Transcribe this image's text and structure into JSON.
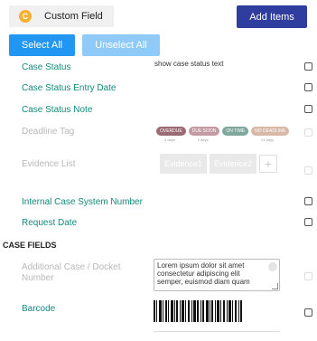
{
  "toolbar": {
    "custom_field_icon": "C",
    "custom_field_label": "Custom Field",
    "add_items_label": "Add Items",
    "select_all_label": "Select All",
    "unselect_all_label": "Unselect All"
  },
  "fields": [
    {
      "label": "Case Status",
      "preview": "show case status text"
    },
    {
      "label": "Case Status Entry Date"
    },
    {
      "label": "Case Status Note"
    },
    {
      "label": "Deadline Tag"
    },
    {
      "label": "Evidence List"
    },
    {
      "label": "Internal Case System Number"
    },
    {
      "label": "Request Date"
    }
  ],
  "deadline_tags": [
    {
      "text": "OVERDUE",
      "sub": "3 days",
      "color": "#9b6a73"
    },
    {
      "text": "DUE SOON",
      "sub": "2 days",
      "color": "#c49aa3"
    },
    {
      "text": "ON TIME",
      "sub": "",
      "color": "#7fa79c"
    },
    {
      "text": "NO DEADLINE",
      "sub": "21 days",
      "color": "#d8b8a7"
    }
  ],
  "evidence": {
    "chips": [
      "Evidence1",
      "Evidence2"
    ],
    "add_symbol": "+"
  },
  "case_fields": {
    "title": "CASE FIELDS",
    "additional_label": "Additional Case / Docket Number",
    "lorem_text": "Lorem ipsum dolor sit amet consectetur adipiscing elit semper, euismod diam quam",
    "barcode_label": "Barcode"
  },
  "colors": {
    "accent_teal": "#14897f",
    "primary_blue": "#2196f3",
    "navy": "#2f3e9e"
  }
}
